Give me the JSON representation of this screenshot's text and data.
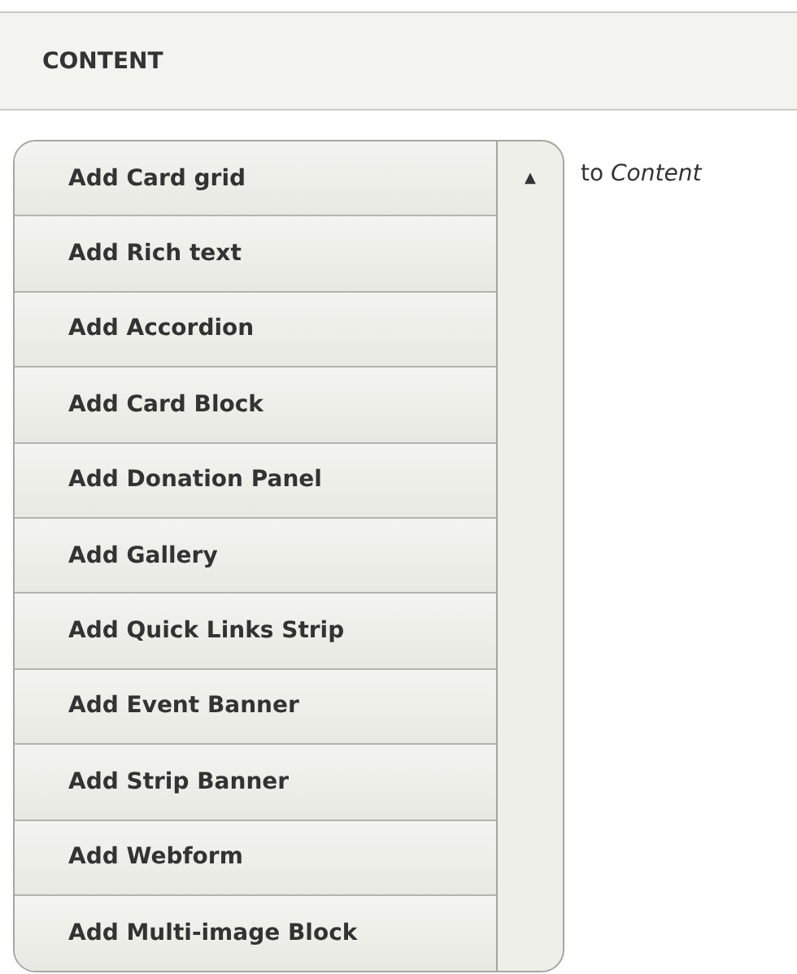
{
  "section": {
    "title": "CONTENT"
  },
  "dropdown": {
    "items": [
      {
        "label": "Add Card grid"
      },
      {
        "label": "Add Rich text"
      },
      {
        "label": "Add Accordion"
      },
      {
        "label": "Add Card Block"
      },
      {
        "label": "Add Donation Panel"
      },
      {
        "label": "Add Gallery"
      },
      {
        "label": "Add Quick Links Strip"
      },
      {
        "label": "Add Event Banner"
      },
      {
        "label": "Add Strip Banner"
      },
      {
        "label": "Add Webform"
      },
      {
        "label": "Add Multi-image Block"
      }
    ],
    "toggle": "▲",
    "suffix": "to *Content*"
  }
}
